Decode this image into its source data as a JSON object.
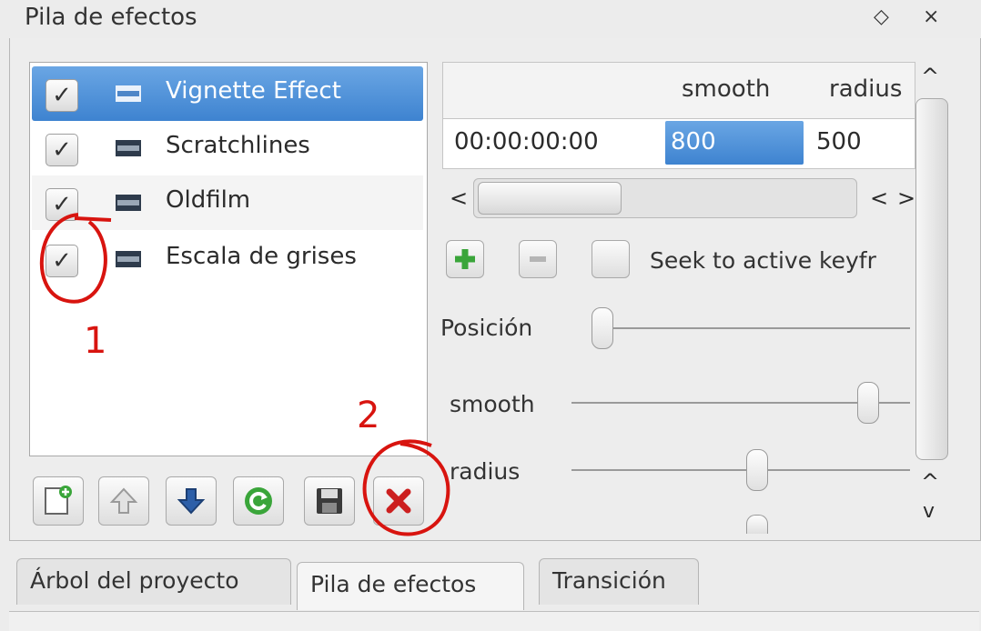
{
  "dock": {
    "title": "Pila de efectos",
    "float_glyph": "◇",
    "close_glyph": "×"
  },
  "effects": [
    {
      "label": "Vignette Effect",
      "checked": true,
      "selected": true
    },
    {
      "label": "Scratchlines",
      "checked": true,
      "selected": false
    },
    {
      "label": "Oldfilm",
      "checked": true,
      "selected": false
    },
    {
      "label": "Escala de grises",
      "checked": true,
      "selected": false
    }
  ],
  "toolbar": {
    "add_icon": "add-effect-icon",
    "up_icon": "arrow-up-icon",
    "down_icon": "arrow-down-icon",
    "reset_icon": "reset-icon",
    "save_icon": "save-icon",
    "delete_icon": "delete-icon"
  },
  "keyframes": {
    "columns": [
      "smooth",
      "radius"
    ],
    "rows": [
      {
        "time": "00:00:00:00",
        "smooth": "800",
        "radius": "500"
      }
    ],
    "seek_label": "Seek to active keyfr"
  },
  "params": {
    "position_label": "Posición",
    "smooth_label": "smooth",
    "radius_label": "radius"
  },
  "tabs": [
    "Árbol del proyecto",
    "Pila de efectos",
    "Transición"
  ],
  "annotations": {
    "one": "1",
    "two": "2"
  },
  "colors": {
    "selection": "#3e83d0",
    "annotation": "#d8140f",
    "add_green": "#3aa53a",
    "delete_red": "#cc1f1f",
    "arrow_blue": "#2d5fa8"
  }
}
